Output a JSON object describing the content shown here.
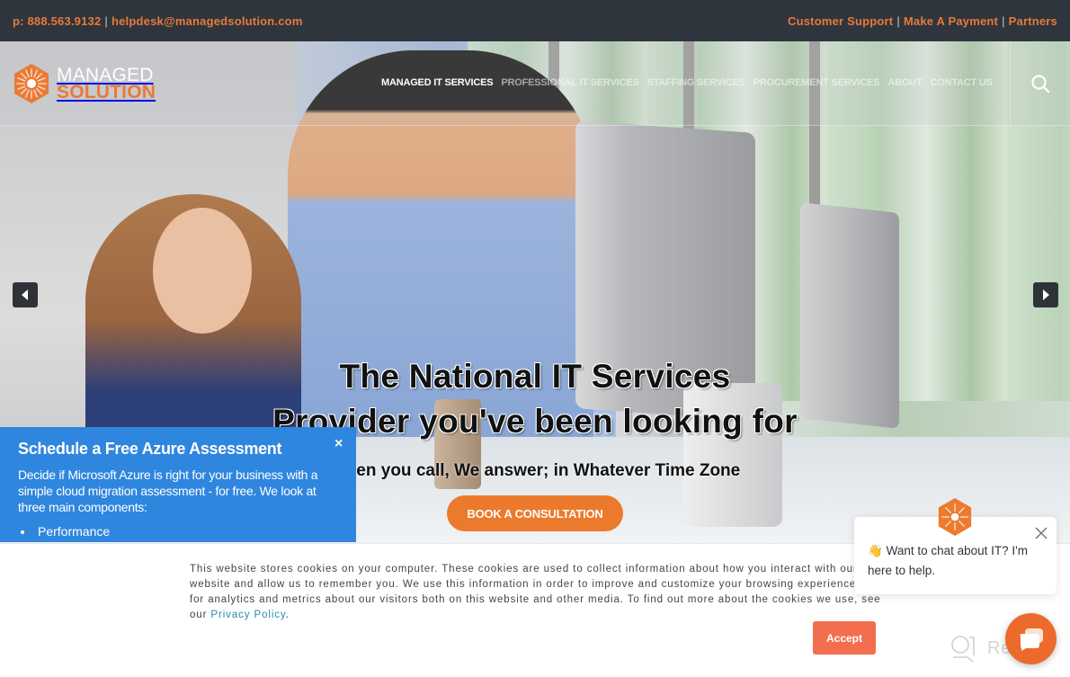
{
  "topbar": {
    "phone": "p: 888.563.9132",
    "separator": "|",
    "email": "helpdesk@managedsolution.com",
    "links": [
      "Customer Support",
      "Make A Payment",
      "Partners"
    ]
  },
  "brand": {
    "line1": "MANAGED",
    "line2": "SOLUTION",
    "accent_color": "#e97a36"
  },
  "nav": {
    "items": [
      {
        "label": "MANAGED IT SERVICES",
        "active": true
      },
      {
        "label": "PROFESSIONAL IT SERVICES",
        "active": false
      },
      {
        "label": "STAFFING SERVICES",
        "active": false
      },
      {
        "label": "PROCUREMENT SERVICES",
        "active": false
      },
      {
        "label": "ABOUT",
        "active": false
      },
      {
        "label": "CONTACT US",
        "active": false
      }
    ],
    "search_icon": "search-icon"
  },
  "hero": {
    "title_line1": "The National IT Services",
    "title_line2": "Provider you've been looking for",
    "subtitle": "When you call, We answer; in Whatever Time Zone",
    "cta_label": "BOOK A CONSULTATION",
    "prev_icon": "caret-left-icon",
    "next_icon": "caret-right-icon"
  },
  "azure_popup": {
    "title": "Schedule a Free Azure Assessment",
    "body": "Decide if Microsoft Azure is right for your business with a simple cloud migration assessment - for free. We look at three main components:",
    "items": [
      "Performance"
    ],
    "close_label": "×",
    "color": "#2f86de"
  },
  "cookie_banner": {
    "text": "This website stores cookies on your computer. These cookies are used to collect information about how you interact with our website and allow us to remember you. We use this information in order to improve and customize your browsing experience and for analytics and metrics about our visitors both on this website and other media. To find out more about the cookies we use, see our ",
    "link_label": "Privacy Policy",
    "trailing": ".",
    "accept_label": "Accept"
  },
  "chat": {
    "emoji": "👋",
    "message": "Want to chat about IT? I'm here to help.",
    "close_icon": "close-icon"
  },
  "watermark": {
    "label": "Revain"
  }
}
